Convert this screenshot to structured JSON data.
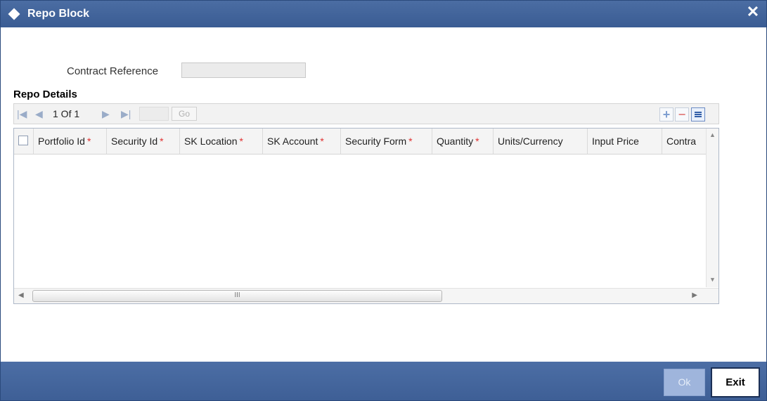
{
  "window": {
    "title": "Repo Block",
    "close_glyph": "✕"
  },
  "form": {
    "contract_reference_label": "Contract Reference",
    "contract_reference_value": ""
  },
  "repo_details": {
    "section_title": "Repo Details",
    "pagination": {
      "page_text": "1 Of 1",
      "go_label": "Go",
      "page_input_value": ""
    },
    "columns": [
      {
        "label": "Portfolio Id",
        "required": true
      },
      {
        "label": "Security Id",
        "required": true
      },
      {
        "label": "SK Location",
        "required": true
      },
      {
        "label": "SK Account",
        "required": true
      },
      {
        "label": "Security Form",
        "required": true
      },
      {
        "label": "Quantity",
        "required": true
      },
      {
        "label": "Units/Currency",
        "required": false
      },
      {
        "label": "Input Price",
        "required": false
      },
      {
        "label": "Contra",
        "required": false
      }
    ],
    "rows": [],
    "toolbar_icons": [
      "add-row-icon",
      "delete-row-icon",
      "single-view-icon"
    ],
    "scroll_thumb_glyph": "III"
  },
  "footer": {
    "ok_label": "Ok",
    "exit_label": "Exit"
  },
  "colors": {
    "titlebar": "#3a5c93",
    "footer": "#4465a0",
    "required_marker": "#e03030",
    "ok_disabled": "#9fb5dc"
  }
}
